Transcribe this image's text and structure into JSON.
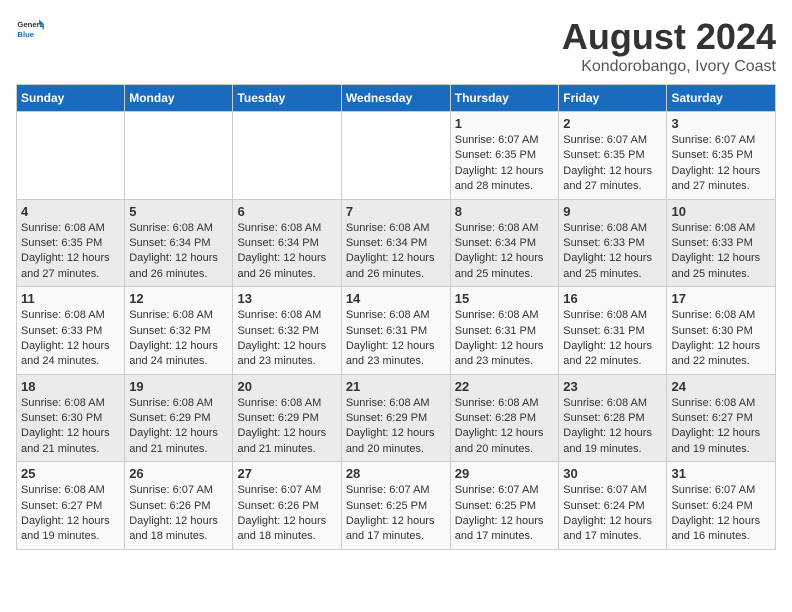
{
  "header": {
    "logo_general": "General",
    "logo_blue": "Blue",
    "title": "August 2024",
    "subtitle": "Kondorobango, Ivory Coast"
  },
  "days_of_week": [
    "Sunday",
    "Monday",
    "Tuesday",
    "Wednesday",
    "Thursday",
    "Friday",
    "Saturday"
  ],
  "weeks": [
    [
      {
        "day": "",
        "info": ""
      },
      {
        "day": "",
        "info": ""
      },
      {
        "day": "",
        "info": ""
      },
      {
        "day": "",
        "info": ""
      },
      {
        "day": "1",
        "info": "Sunrise: 6:07 AM\nSunset: 6:35 PM\nDaylight: 12 hours\nand 28 minutes."
      },
      {
        "day": "2",
        "info": "Sunrise: 6:07 AM\nSunset: 6:35 PM\nDaylight: 12 hours\nand 27 minutes."
      },
      {
        "day": "3",
        "info": "Sunrise: 6:07 AM\nSunset: 6:35 PM\nDaylight: 12 hours\nand 27 minutes."
      }
    ],
    [
      {
        "day": "4",
        "info": "Sunrise: 6:08 AM\nSunset: 6:35 PM\nDaylight: 12 hours\nand 27 minutes."
      },
      {
        "day": "5",
        "info": "Sunrise: 6:08 AM\nSunset: 6:34 PM\nDaylight: 12 hours\nand 26 minutes."
      },
      {
        "day": "6",
        "info": "Sunrise: 6:08 AM\nSunset: 6:34 PM\nDaylight: 12 hours\nand 26 minutes."
      },
      {
        "day": "7",
        "info": "Sunrise: 6:08 AM\nSunset: 6:34 PM\nDaylight: 12 hours\nand 26 minutes."
      },
      {
        "day": "8",
        "info": "Sunrise: 6:08 AM\nSunset: 6:34 PM\nDaylight: 12 hours\nand 25 minutes."
      },
      {
        "day": "9",
        "info": "Sunrise: 6:08 AM\nSunset: 6:33 PM\nDaylight: 12 hours\nand 25 minutes."
      },
      {
        "day": "10",
        "info": "Sunrise: 6:08 AM\nSunset: 6:33 PM\nDaylight: 12 hours\nand 25 minutes."
      }
    ],
    [
      {
        "day": "11",
        "info": "Sunrise: 6:08 AM\nSunset: 6:33 PM\nDaylight: 12 hours\nand 24 minutes."
      },
      {
        "day": "12",
        "info": "Sunrise: 6:08 AM\nSunset: 6:32 PM\nDaylight: 12 hours\nand 24 minutes."
      },
      {
        "day": "13",
        "info": "Sunrise: 6:08 AM\nSunset: 6:32 PM\nDaylight: 12 hours\nand 23 minutes."
      },
      {
        "day": "14",
        "info": "Sunrise: 6:08 AM\nSunset: 6:31 PM\nDaylight: 12 hours\nand 23 minutes."
      },
      {
        "day": "15",
        "info": "Sunrise: 6:08 AM\nSunset: 6:31 PM\nDaylight: 12 hours\nand 23 minutes."
      },
      {
        "day": "16",
        "info": "Sunrise: 6:08 AM\nSunset: 6:31 PM\nDaylight: 12 hours\nand 22 minutes."
      },
      {
        "day": "17",
        "info": "Sunrise: 6:08 AM\nSunset: 6:30 PM\nDaylight: 12 hours\nand 22 minutes."
      }
    ],
    [
      {
        "day": "18",
        "info": "Sunrise: 6:08 AM\nSunset: 6:30 PM\nDaylight: 12 hours\nand 21 minutes."
      },
      {
        "day": "19",
        "info": "Sunrise: 6:08 AM\nSunset: 6:29 PM\nDaylight: 12 hours\nand 21 minutes."
      },
      {
        "day": "20",
        "info": "Sunrise: 6:08 AM\nSunset: 6:29 PM\nDaylight: 12 hours\nand 21 minutes."
      },
      {
        "day": "21",
        "info": "Sunrise: 6:08 AM\nSunset: 6:29 PM\nDaylight: 12 hours\nand 20 minutes."
      },
      {
        "day": "22",
        "info": "Sunrise: 6:08 AM\nSunset: 6:28 PM\nDaylight: 12 hours\nand 20 minutes."
      },
      {
        "day": "23",
        "info": "Sunrise: 6:08 AM\nSunset: 6:28 PM\nDaylight: 12 hours\nand 19 minutes."
      },
      {
        "day": "24",
        "info": "Sunrise: 6:08 AM\nSunset: 6:27 PM\nDaylight: 12 hours\nand 19 minutes."
      }
    ],
    [
      {
        "day": "25",
        "info": "Sunrise: 6:08 AM\nSunset: 6:27 PM\nDaylight: 12 hours\nand 19 minutes."
      },
      {
        "day": "26",
        "info": "Sunrise: 6:07 AM\nSunset: 6:26 PM\nDaylight: 12 hours\nand 18 minutes."
      },
      {
        "day": "27",
        "info": "Sunrise: 6:07 AM\nSunset: 6:26 PM\nDaylight: 12 hours\nand 18 minutes."
      },
      {
        "day": "28",
        "info": "Sunrise: 6:07 AM\nSunset: 6:25 PM\nDaylight: 12 hours\nand 17 minutes."
      },
      {
        "day": "29",
        "info": "Sunrise: 6:07 AM\nSunset: 6:25 PM\nDaylight: 12 hours\nand 17 minutes."
      },
      {
        "day": "30",
        "info": "Sunrise: 6:07 AM\nSunset: 6:24 PM\nDaylight: 12 hours\nand 17 minutes."
      },
      {
        "day": "31",
        "info": "Sunrise: 6:07 AM\nSunset: 6:24 PM\nDaylight: 12 hours\nand 16 minutes."
      }
    ]
  ]
}
